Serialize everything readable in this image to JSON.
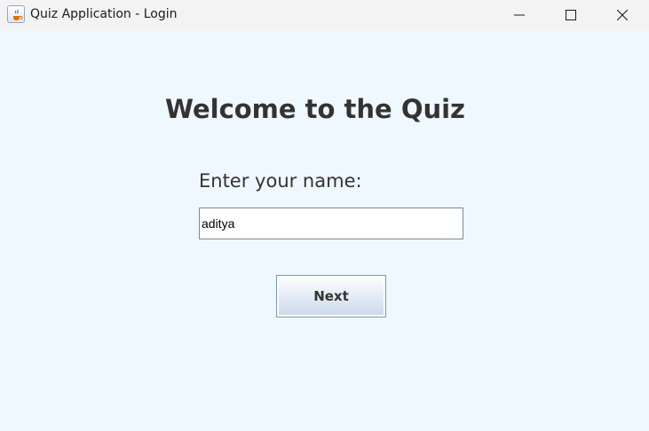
{
  "window": {
    "title": "Quiz Application - Login",
    "icons": {
      "app": "java-cup-icon",
      "minimize": "minimize-icon",
      "maximize": "maximize-icon",
      "close": "close-icon"
    }
  },
  "login": {
    "heading": "Welcome to the Quiz",
    "name_label": "Enter your name:",
    "name_value": "aditya",
    "next_label": "Next"
  },
  "colors": {
    "background": "#f0f8ff",
    "titlebar": "#f3f3f3",
    "text": "#333333"
  }
}
